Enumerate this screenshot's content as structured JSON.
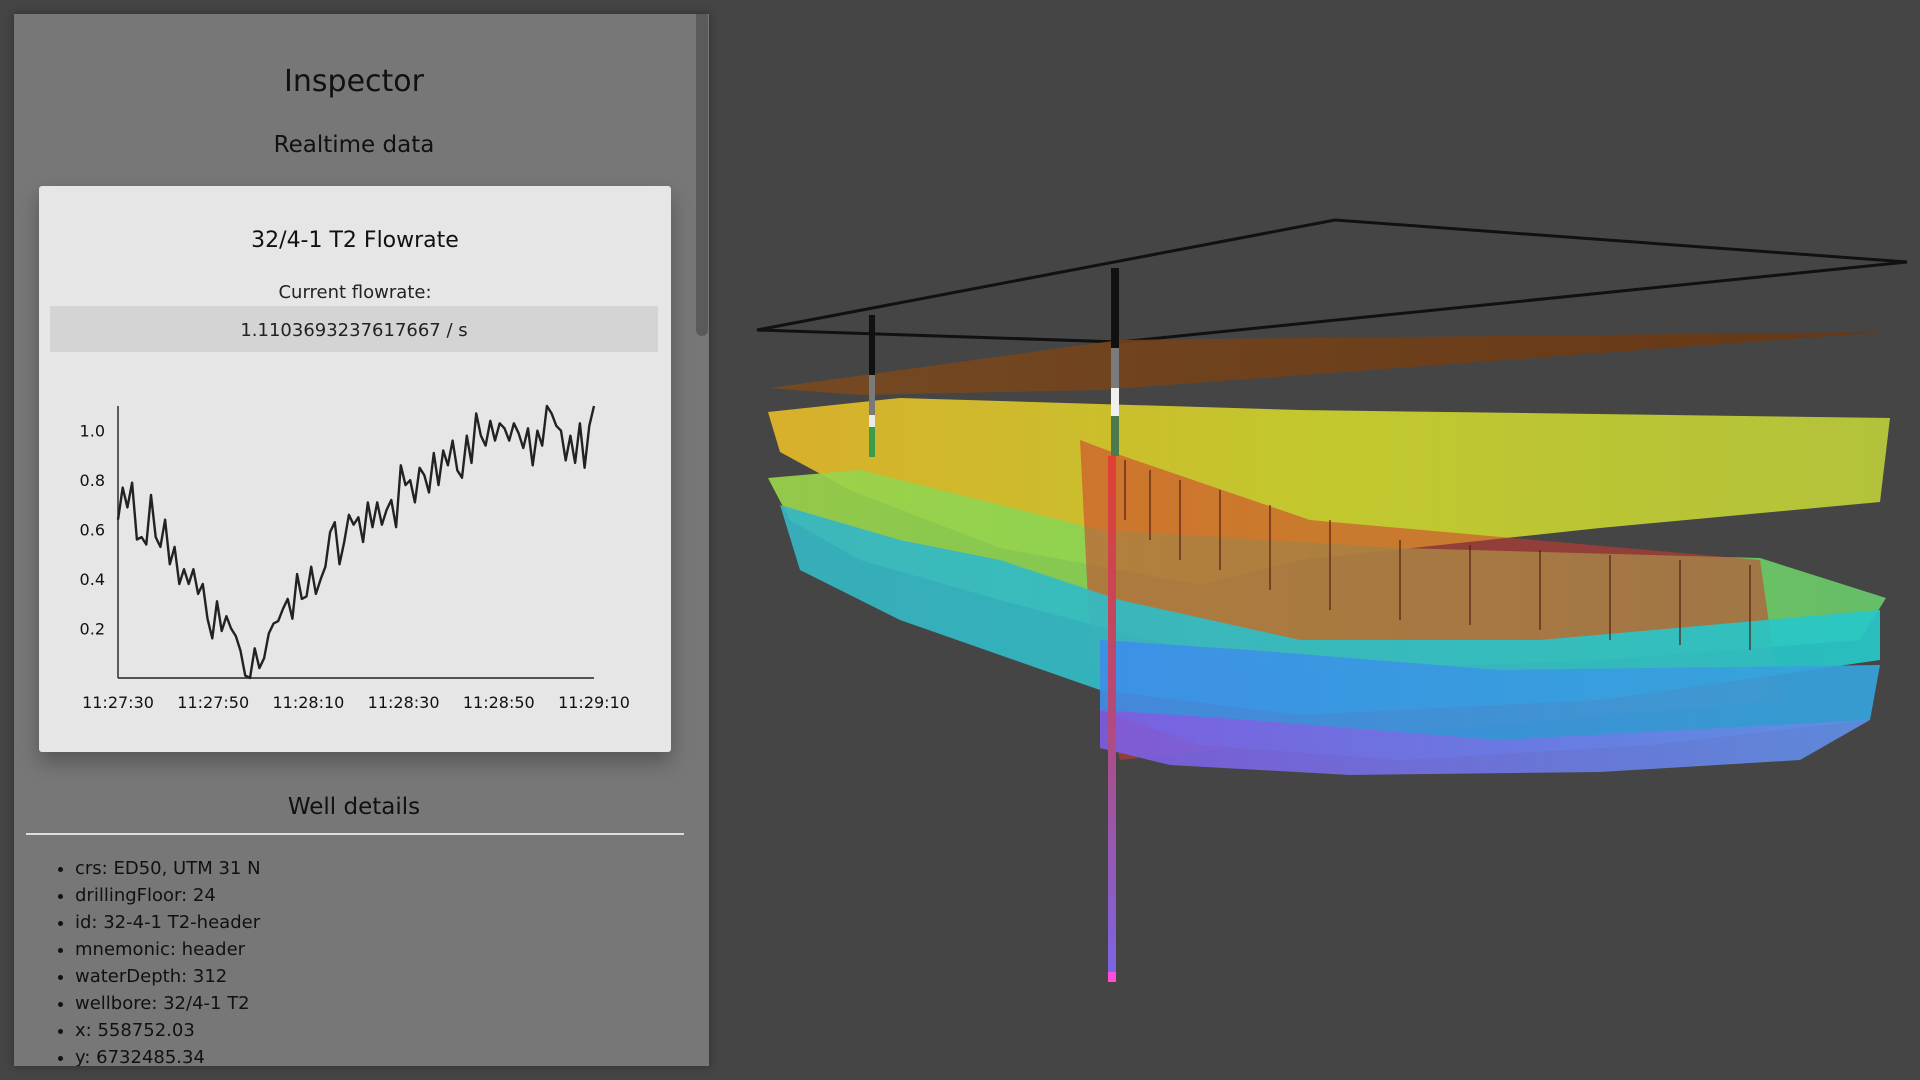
{
  "inspector": {
    "title": "Inspector",
    "realtime_subtitle": "Realtime data",
    "well_subtitle": "Well details"
  },
  "card": {
    "title": "32/4-1 T2 Flowrate",
    "flow_label": "Current flowrate:",
    "flow_value": "1.1103693237617667 / s"
  },
  "well_details": [
    "crs: ED50, UTM 31 N",
    "drillingFloor: 24",
    "id: 32-4-1 T2-header",
    "mnemonic: header",
    "waterDepth: 312",
    "wellbore: 32/4-1 T2",
    "x: 558752.03",
    "y: 6732485.34"
  ],
  "colors": {
    "background": "#454545",
    "panel": "#777777",
    "card": "#e6e6e6",
    "value_box": "#d4d4d4",
    "series_line": "#222222"
  },
  "scene": {
    "description_layers": [
      "orange",
      "yellow",
      "green",
      "cyan",
      "blue",
      "violet"
    ]
  },
  "chart_data": {
    "type": "line",
    "x_tick_labels": [
      "11:27:30",
      "11:27:50",
      "11:28:10",
      "11:28:30",
      "11:28:50",
      "11:29:10"
    ],
    "y_tick_labels": [
      "0.2",
      "0.4",
      "0.6",
      "0.8",
      "1.0"
    ],
    "x_range_seconds": [
      0,
      100
    ],
    "ylim": [
      0,
      1.1
    ],
    "series": [
      {
        "values": [
          0.64,
          0.77,
          0.69,
          0.79,
          0.56,
          0.57,
          0.54,
          0.74,
          0.57,
          0.53,
          0.64,
          0.46,
          0.53,
          0.38,
          0.44,
          0.38,
          0.44,
          0.34,
          0.38,
          0.24,
          0.16,
          0.31,
          0.19,
          0.25,
          0.2,
          0.17,
          0.11,
          0.01,
          0.0,
          0.12,
          0.04,
          0.08,
          0.18,
          0.22,
          0.23,
          0.28,
          0.32,
          0.24,
          0.42,
          0.32,
          0.33,
          0.45,
          0.34,
          0.4,
          0.45,
          0.59,
          0.63,
          0.46,
          0.55,
          0.66,
          0.62,
          0.65,
          0.55,
          0.71,
          0.61,
          0.71,
          0.62,
          0.68,
          0.72,
          0.61,
          0.86,
          0.78,
          0.8,
          0.71,
          0.85,
          0.82,
          0.75,
          0.91,
          0.78,
          0.92,
          0.86,
          0.96,
          0.84,
          0.81,
          0.98,
          0.87,
          1.07,
          0.98,
          0.94,
          1.04,
          0.96,
          1.03,
          1.01,
          0.96,
          1.03,
          0.99,
          0.93,
          1.01,
          0.86,
          1.0,
          0.94,
          1.1,
          1.07,
          1.02,
          1.0,
          0.88,
          0.98,
          0.87,
          1.03,
          0.85,
          1.02,
          1.1
        ]
      }
    ]
  }
}
